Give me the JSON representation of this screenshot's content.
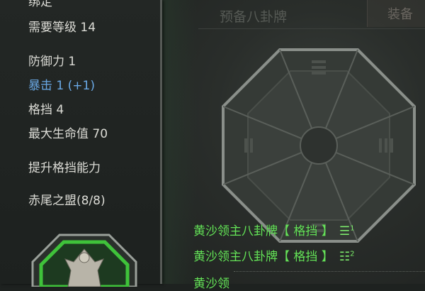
{
  "header": {
    "title": "预备八卦牌",
    "equip_label": "装备"
  },
  "tooltip": {
    "cut_line": "绑定",
    "level_req": "需要等级 14",
    "defense": "防御力 1",
    "crit": "暴击 1 (+1)",
    "block": "格挡 4",
    "max_hp": "最大生命值 70",
    "effect": "提升格挡能力",
    "set_name": "赤尾之盟(8/8)"
  },
  "set_items": [
    {
      "name": "黄沙领主八卦牌【 格挡 】",
      "glyph": "☰",
      "index": "1"
    },
    {
      "name": "黄沙领主八卦牌【 格挡 】",
      "glyph": "☷",
      "index": "2"
    },
    {
      "name": "黄沙领",
      "glyph": "",
      "index": ""
    }
  ],
  "colors": {
    "set_green": "#66e05a",
    "crit_blue": "#6aa9e6",
    "text_white": "#dcdcd6"
  }
}
